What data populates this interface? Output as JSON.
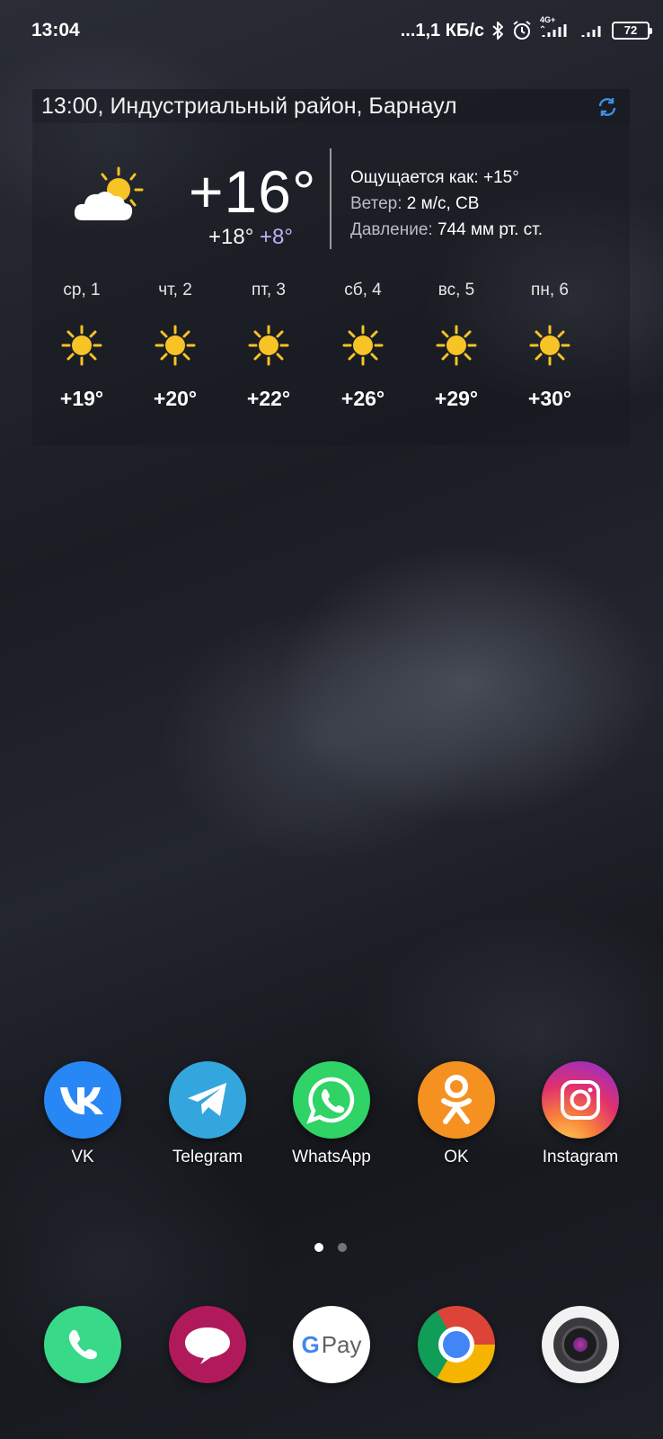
{
  "status_bar": {
    "time": "13:04",
    "net_speed": "...1,1 КБ/с",
    "network_type": "4G+",
    "battery": "72",
    "icons": [
      "bluetooth-icon",
      "alarm-icon",
      "signal-icon",
      "signal-icon",
      "battery-icon"
    ]
  },
  "weather": {
    "header": "13:00, Индустриальный район, Барнаул",
    "refresh_icon": "refresh-icon",
    "current": {
      "icon": "partly-cloudy-icon",
      "temp": "+16°",
      "high": "+18°",
      "low": "+8°"
    },
    "details": [
      {
        "label": "Ощущается как:",
        "value": " +15°"
      },
      {
        "label": "Ветер:",
        "value": " 2 м/с, СВ"
      },
      {
        "label": "Давление:",
        "value": " 744 мм рт. ст."
      }
    ],
    "forecast": [
      {
        "day": "ср, 1",
        "icon": "sun-icon",
        "temp": "+19°"
      },
      {
        "day": "чт, 2",
        "icon": "sun-icon",
        "temp": "+20°"
      },
      {
        "day": "пт, 3",
        "icon": "sun-icon",
        "temp": "+22°"
      },
      {
        "day": "сб, 4",
        "icon": "sun-icon",
        "temp": "+26°"
      },
      {
        "day": "вс, 5",
        "icon": "sun-icon",
        "temp": "+29°"
      },
      {
        "day": "пн, 6",
        "icon": "sun-icon",
        "temp": "+30°"
      }
    ]
  },
  "apps": [
    {
      "label": "VK",
      "icon": "vk-icon",
      "color": "#2787f5"
    },
    {
      "label": "Telegram",
      "icon": "telegram-icon",
      "color": "#34a6de"
    },
    {
      "label": "WhatsApp",
      "icon": "whatsapp-icon",
      "color": "#2fd366"
    },
    {
      "label": "OK",
      "icon": "ok-icon",
      "color": "#f59120"
    },
    {
      "label": "Instagram",
      "icon": "instagram-icon",
      "color": "#d6297a"
    }
  ],
  "pages": {
    "count": 2,
    "active": 1
  },
  "dock": [
    {
      "name": "phone",
      "icon": "phone-icon",
      "color": "#39d98a"
    },
    {
      "name": "messages",
      "icon": "message-icon",
      "color": "#b01a5a"
    },
    {
      "name": "gpay",
      "icon": "gpay-icon",
      "text": "Pay",
      "color": "#ffffff"
    },
    {
      "name": "chrome",
      "icon": "chrome-icon",
      "color": "#ffffff"
    },
    {
      "name": "camera",
      "icon": "camera-icon",
      "color": "#f2f2f2"
    }
  ]
}
